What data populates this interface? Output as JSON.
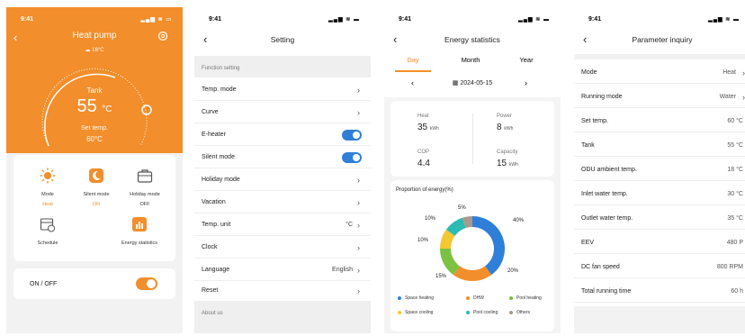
{
  "status_time": "9:41",
  "home": {
    "title": "Heat pump",
    "weather": "18°C",
    "tank_label": "Tank",
    "tank_value": "55",
    "tank_unit": "°C",
    "set_label": "Set temp.",
    "set_value": "60°C",
    "accent": "#f28e2b",
    "functions": [
      {
        "label": "Mode",
        "status": "Heat",
        "icon": "sun-icon"
      },
      {
        "label": "Silent mode",
        "status": "ON",
        "icon": "moon-icon"
      },
      {
        "label": "Holiday mode",
        "status": "OFF",
        "icon": "suitcase-icon"
      },
      {
        "label": "Schedule",
        "status": "",
        "icon": "calendar-icon"
      },
      {
        "label": "Energy statistics",
        "status": "",
        "icon": "bar-chart-icon"
      }
    ],
    "onoff_label": "ON / OFF"
  },
  "setting": {
    "title": "Setting",
    "section": "Function setting",
    "rows": [
      {
        "label": "Temp. mode",
        "value": ""
      },
      {
        "label": "Curve",
        "value": ""
      },
      {
        "label": "E-heater",
        "value": ""
      },
      {
        "label": "Silent mode",
        "value": ""
      },
      {
        "label": "Holiday mode",
        "value": ""
      },
      {
        "label": "Vacation",
        "value": ""
      },
      {
        "label": "Temp. unit",
        "value": "°C"
      },
      {
        "label": "Clock",
        "value": ""
      },
      {
        "label": "Language",
        "value": "English"
      },
      {
        "label": "Reset",
        "value": ""
      }
    ],
    "about": "About us"
  },
  "energy": {
    "title": "Energy statistics",
    "tabs": [
      "Day",
      "Month",
      "Year"
    ],
    "date": "2024-05-15",
    "stats": [
      {
        "label": "Heat",
        "value": "35",
        "unit": "kWh"
      },
      {
        "label": "Power",
        "value": "8",
        "unit": "kWh"
      },
      {
        "label": "COP",
        "value": "4.4",
        "unit": ""
      },
      {
        "label": "Capacity",
        "value": "15",
        "unit": "kWh"
      }
    ],
    "proportion_title": "Proportion of energy(%)",
    "chart_data": {
      "type": "pie",
      "title": "Proportion of energy(%)",
      "series": [
        {
          "name": "Space heating",
          "value": 40,
          "color": "#2f7fd8"
        },
        {
          "name": "DHW",
          "value": 20,
          "color": "#f28e2b"
        },
        {
          "name": "Pool heating",
          "value": 15,
          "color": "#7cc242"
        },
        {
          "name": "Space cooling",
          "value": 10,
          "color": "#f5c832"
        },
        {
          "name": "Pool cooling",
          "value": 10,
          "color": "#2bbbb4"
        },
        {
          "name": "Others",
          "value": 5,
          "color": "#a8998a"
        }
      ],
      "labels": [
        "40%",
        "20%",
        "15%",
        "10%",
        "10%",
        "5%"
      ]
    }
  },
  "params": {
    "title": "Parameter inquiry",
    "rows": [
      {
        "label": "Mode",
        "value": "Heat"
      },
      {
        "label": "Running mode",
        "value": "Water"
      },
      {
        "label": "Set temp.",
        "value": "60 °C"
      },
      {
        "label": "Tank",
        "value": "55 °C"
      },
      {
        "label": "ODU ambient temp.",
        "value": "18 °C"
      },
      {
        "label": "Inlet water temp.",
        "value": "30 °C"
      },
      {
        "label": "Outlet water temp.",
        "value": "35 °C"
      },
      {
        "label": "EEV",
        "value": "480 P"
      },
      {
        "label": "DC fan speed",
        "value": "800 RPM"
      },
      {
        "label": "Total running time",
        "value": "60 h"
      }
    ]
  }
}
